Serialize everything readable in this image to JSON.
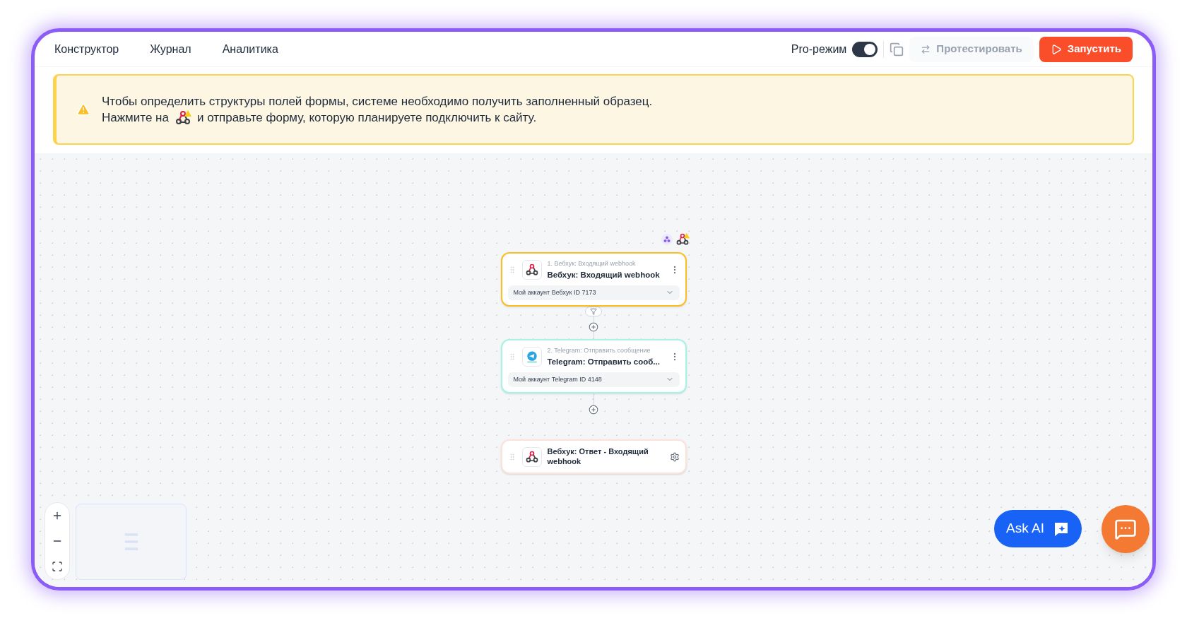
{
  "tabs": [
    {
      "label": "Конструктор"
    },
    {
      "label": "Журнал"
    },
    {
      "label": "Аналитика"
    }
  ],
  "pro_mode": {
    "label": "Pro-режим",
    "on": true
  },
  "test_button": {
    "label": "Протестировать",
    "disabled": true
  },
  "run_button": {
    "label": "Запустить"
  },
  "banner": {
    "line1": "Чтобы определить структуры полей формы, системе необходимо получить заполненный образец.",
    "line2_before": "Нажмите на",
    "line2_after": "и отправьте форму, которую планируете подключить к сайту."
  },
  "nodes": [
    {
      "kind": "webhook",
      "color": "#fbbf24",
      "step": "1. Вебхук: Входящий webhook",
      "title": "Вебхук: Входящий webhook",
      "account": "Мой аккаунт Вебхук ID 7173",
      "warning": true
    },
    {
      "kind": "telegram",
      "color": "#a7f3e4",
      "step": "2. Telegram: Отправить сообщение",
      "title": "Telegram: Отправить сооб...",
      "account": "Мой аккаунт Telegram ID 4148",
      "warning": false
    },
    {
      "kind": "response",
      "color": "#fde2dc",
      "title": "Вебхук: Ответ - Входящий webhook"
    }
  ],
  "ask_ai": {
    "label": "Ask AI"
  }
}
